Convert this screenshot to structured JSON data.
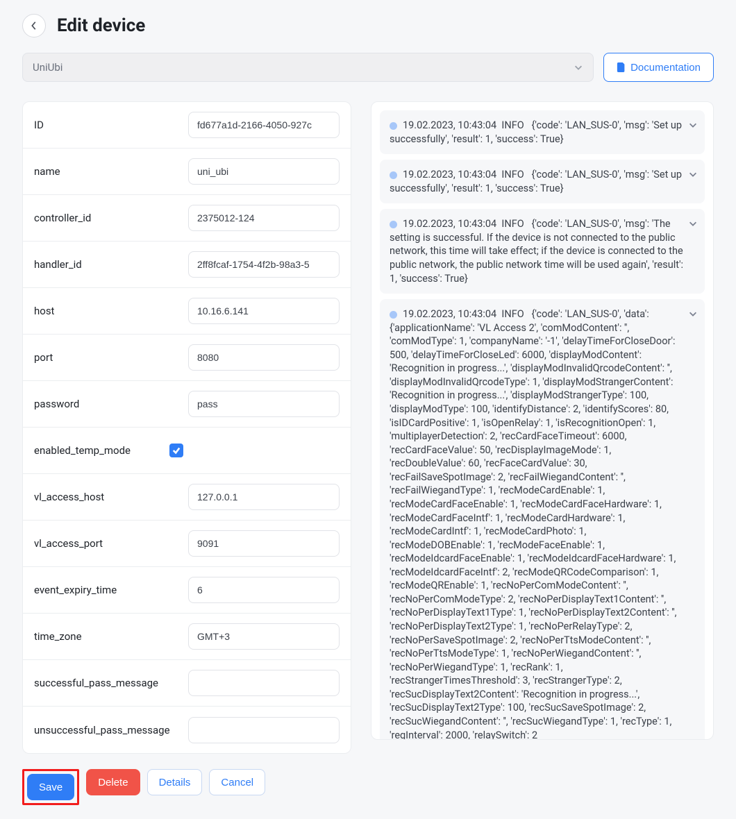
{
  "page_title": "Edit device",
  "device_type_select": {
    "selected": "UniUbi"
  },
  "documentation_button": "Documentation",
  "form_fields": [
    {
      "key": "id",
      "label": "ID",
      "value": "fd677a1d-2166-4050-927c",
      "type": "text"
    },
    {
      "key": "name",
      "label": "name",
      "value": "uni_ubi",
      "type": "text"
    },
    {
      "key": "controller_id",
      "label": "controller_id",
      "value": "2375012-124",
      "type": "text"
    },
    {
      "key": "handler_id",
      "label": "handler_id",
      "value": "2ff8fcaf-1754-4f2b-98a3-5",
      "type": "text"
    },
    {
      "key": "host",
      "label": "host",
      "value": "10.16.6.141",
      "type": "text"
    },
    {
      "key": "port",
      "label": "port",
      "value": "8080",
      "type": "text"
    },
    {
      "key": "password",
      "label": "password",
      "value": "pass",
      "type": "text"
    },
    {
      "key": "enabled_temp_mode",
      "label": "enabled_temp_mode",
      "value": true,
      "type": "checkbox"
    },
    {
      "key": "vl_access_host",
      "label": "vl_access_host",
      "value": "127.0.0.1",
      "type": "text"
    },
    {
      "key": "vl_access_port",
      "label": "vl_access_port",
      "value": "9091",
      "type": "text"
    },
    {
      "key": "event_expiry_time",
      "label": "event_expiry_time",
      "value": "6",
      "type": "text"
    },
    {
      "key": "time_zone",
      "label": "time_zone",
      "value": "GMT+3",
      "type": "text"
    },
    {
      "key": "successful_pass_message",
      "label": "successful_pass_message",
      "value": "",
      "type": "text"
    },
    {
      "key": "unsuccessful_pass_message",
      "label": "unsuccessful_pass_message",
      "value": "",
      "type": "text"
    }
  ],
  "log_entries": [
    {
      "timestamp": "19.02.2023, 10:43:04",
      "level": "INFO",
      "body": "{'code': 'LAN_SUS-0', 'msg': 'Set up successfully', 'result': 1, 'success': True}"
    },
    {
      "timestamp": "19.02.2023, 10:43:04",
      "level": "INFO",
      "body": "{'code': 'LAN_SUS-0', 'msg': 'Set up successfully', 'result': 1, 'success': True}"
    },
    {
      "timestamp": "19.02.2023, 10:43:04",
      "level": "INFO",
      "body": "{'code': 'LAN_SUS-0', 'msg': 'The setting is successful. If the device is not connected to the public network, this time will take effect; if the device is connected to the public network, the public network time will be used again', 'result': 1, 'success': True}"
    },
    {
      "timestamp": "19.02.2023, 10:43:04",
      "level": "INFO",
      "body": "{'code': 'LAN_SUS-0', 'data': {'applicationName': 'VL Access 2', 'comModContent': '', 'comModType': 1, 'companyName': '-1', 'delayTimeForCloseDoor': 500, 'delayTimeForCloseLed': 6000, 'displayModContent': 'Recognition in progress...', 'displayModInvalidQrcodeContent': '', 'displayModInvalidQrcodeType': 1, 'displayModStrangerContent': 'Recognition in progress...', 'displayModStrangerType': 100, 'displayModType': 100, 'identifyDistance': 2, 'identifyScores': 80, 'isIDCardPositive': 1, 'isOpenRelay': 1, 'isRecognitionOpen': 1, 'multiplayerDetection': 2, 'recCardFaceTimeout': 6000, 'recCardFaceValue': 50, 'recDisplayImageMode': 1, 'recDoubleValue': 60, 'recFaceCardValue': 30, 'recFailSaveSpotImage': 2, 'recFailWiegandContent': '', 'recFailWiegandType': 1, 'recModeCardEnable': 1, 'recModeCardFaceEnable': 1, 'recModeCardFaceHardware': 1, 'recModeCardFaceIntf': 1, 'recModeCardHardware': 1, 'recModeCardIntf': 1, 'recModeCardPhoto': 1, 'recModeDOBEnable': 1, 'recModeFaceEnable': 1, 'recModeIdcardFaceEnable': 1, 'recModeIdcardFaceHardware': 1, 'recModeIdcardFaceIntf': 2, 'recModeQRCodeComparison': 1, 'recModeQREnable': 1, 'recNoPerComModeContent': '', 'recNoPerComModeType': 2, 'recNoPerDisplayText1Content': '', 'recNoPerDisplayText1Type': 1, 'recNoPerDisplayText2Content': '', 'recNoPerDisplayText2Type': 1, 'recNoPerRelayType': 2, 'recNoPerSaveSpotImage': 2, 'recNoPerTtsModeContent': '', 'recNoPerTtsModeType': 1, 'recNoPerWiegandContent': '', 'recNoPerWiegandType': 1, 'recRank': 1, 'recStrangerTimesThreshold': 3, 'recStrangerType': 2, 'recSucDisplayText2Content': 'Recognition in progress...', 'recSucDisplayText2Type': 100, 'recSucSaveSpotImage': 2, 'recSucWiegandContent': '', 'recSucWiegandType': 1, 'recType': 1, 'regInterval': 2000, 'relaySwitch': 2"
    }
  ],
  "footer_buttons": {
    "save": "Save",
    "delete": "Delete",
    "details": "Details",
    "cancel": "Cancel"
  },
  "icons": {
    "back": "chevron-left-icon",
    "dropdown": "chevron-down-icon",
    "document": "document-icon",
    "check": "check-icon",
    "expand": "chevron-down-icon"
  },
  "colors": {
    "primary": "#2f7df6",
    "danger": "#f15348",
    "highlight_border": "#f21d1d"
  }
}
